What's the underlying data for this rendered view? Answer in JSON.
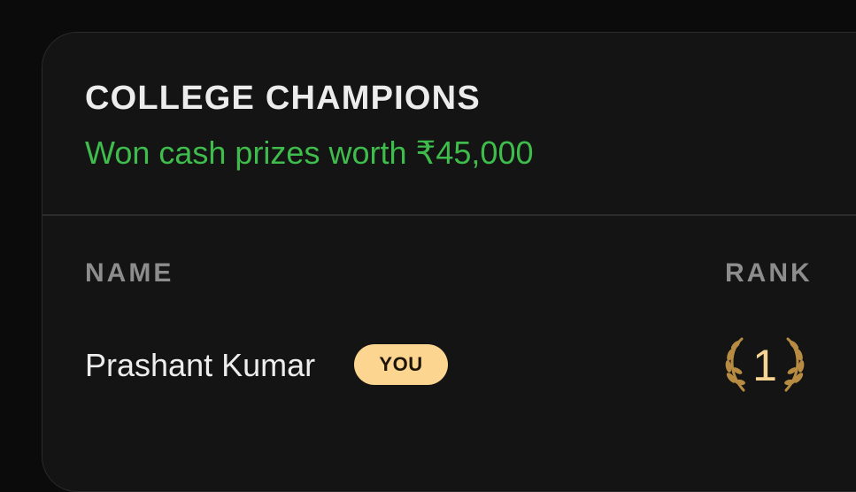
{
  "card": {
    "title": "COLLEGE CHAMPIONS",
    "subtitle": "Won cash prizes worth ₹45,000",
    "subtitle_color": "#3fbd4c"
  },
  "table": {
    "headers": {
      "name": "NAME",
      "rank": "RANK"
    },
    "rows": [
      {
        "name": "Prashant Kumar",
        "badge": "YOU",
        "rank": "1",
        "rank_icon": "laurel-wreath-icon"
      }
    ]
  },
  "colors": {
    "background": "#0b0b0b",
    "card": "#141414",
    "badge": "#fcd591",
    "rank_gold": "#f7d493",
    "wreath": "#b88b42"
  }
}
